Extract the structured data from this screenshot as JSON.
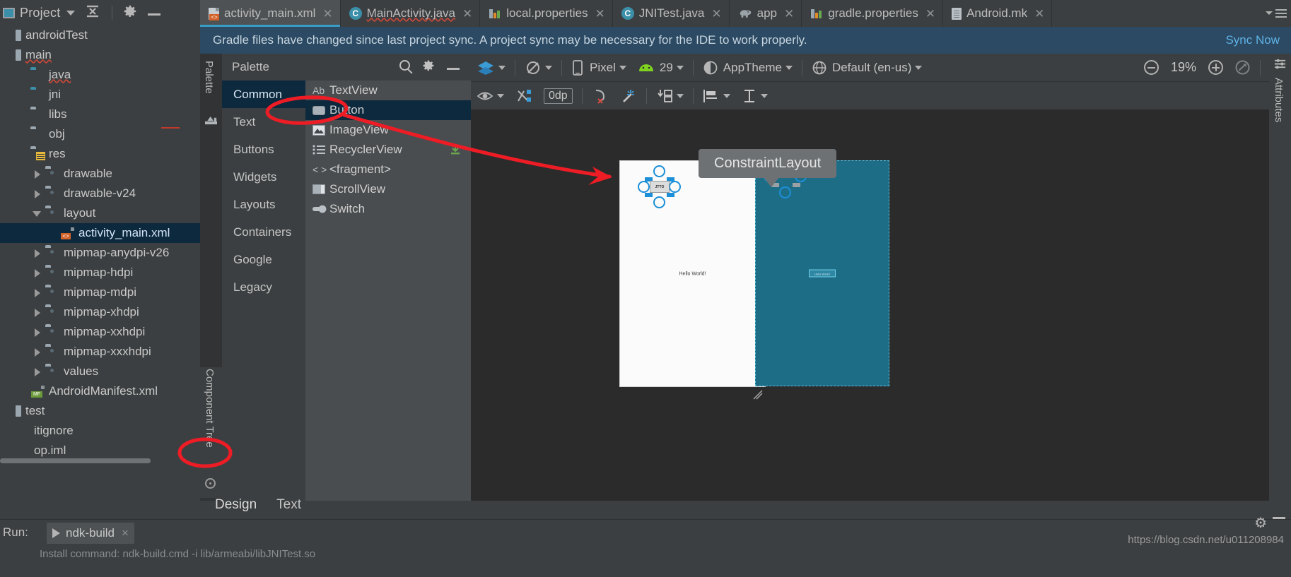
{
  "window": {
    "project_panel_title": "Project",
    "ide": "Android Studio"
  },
  "project_panel": {
    "title": "Project",
    "buttons": {
      "collapse_all": "collapse-all",
      "settings": "settings",
      "hide": "hide"
    },
    "tree": [
      {
        "label": "androidTest",
        "icon": "module-icon",
        "indent": 0,
        "twisty": "none",
        "selected": false,
        "squiggle": false
      },
      {
        "label": "main",
        "icon": "module-icon",
        "indent": 0,
        "twisty": "none",
        "selected": false,
        "squiggle": true
      },
      {
        "label": "java",
        "icon": "source-folder-icon",
        "indent": 1,
        "twisty": "none",
        "selected": false,
        "squiggle": true
      },
      {
        "label": "jni",
        "icon": "source-folder-icon",
        "indent": 1,
        "twisty": "none",
        "selected": false,
        "squiggle": false
      },
      {
        "label": "libs",
        "icon": "folder-icon",
        "indent": 1,
        "twisty": "none",
        "selected": false,
        "squiggle": false
      },
      {
        "label": "obj",
        "icon": "folder-icon",
        "indent": 1,
        "twisty": "none",
        "selected": false,
        "squiggle": false
      },
      {
        "label": "res",
        "icon": "res-folder-icon",
        "indent": 1,
        "twisty": "none",
        "selected": false,
        "squiggle": false
      },
      {
        "label": "drawable",
        "icon": "android-folder-icon",
        "indent": 2,
        "twisty": "closed",
        "selected": false,
        "squiggle": false
      },
      {
        "label": "drawable-v24",
        "icon": "android-folder-icon",
        "indent": 2,
        "twisty": "closed",
        "selected": false,
        "squiggle": false
      },
      {
        "label": "layout",
        "icon": "android-folder-icon",
        "indent": 2,
        "twisty": "open",
        "selected": false,
        "squiggle": false
      },
      {
        "label": "activity_main.xml",
        "icon": "xml-layout-icon",
        "indent": 3,
        "twisty": "none",
        "selected": true,
        "squiggle": false
      },
      {
        "label": "mipmap-anydpi-v26",
        "icon": "android-folder-icon",
        "indent": 2,
        "twisty": "closed",
        "selected": false,
        "squiggle": false
      },
      {
        "label": "mipmap-hdpi",
        "icon": "android-folder-icon",
        "indent": 2,
        "twisty": "closed",
        "selected": false,
        "squiggle": false
      },
      {
        "label": "mipmap-mdpi",
        "icon": "android-folder-icon",
        "indent": 2,
        "twisty": "closed",
        "selected": false,
        "squiggle": false
      },
      {
        "label": "mipmap-xhdpi",
        "icon": "android-folder-icon",
        "indent": 2,
        "twisty": "closed",
        "selected": false,
        "squiggle": false
      },
      {
        "label": "mipmap-xxhdpi",
        "icon": "android-folder-icon",
        "indent": 2,
        "twisty": "closed",
        "selected": false,
        "squiggle": false
      },
      {
        "label": "mipmap-xxxhdpi",
        "icon": "android-folder-icon",
        "indent": 2,
        "twisty": "closed",
        "selected": false,
        "squiggle": false
      },
      {
        "label": "values",
        "icon": "android-folder-icon",
        "indent": 2,
        "twisty": "closed",
        "selected": false,
        "squiggle": false
      },
      {
        "label": "AndroidManifest.xml",
        "icon": "manifest-icon",
        "indent": 1,
        "twisty": "none",
        "selected": false,
        "squiggle": false
      },
      {
        "label": "test",
        "icon": "module-icon",
        "indent": 0,
        "twisty": "none",
        "selected": false,
        "squiggle": false
      },
      {
        "label": "itignore",
        "icon": "none",
        "indent": 0,
        "twisty": "none",
        "selected": false,
        "squiggle": false
      },
      {
        "label": "op.iml",
        "icon": "none",
        "indent": 0,
        "twisty": "none",
        "selected": false,
        "squiggle": false
      }
    ]
  },
  "editor_tabs": [
    {
      "label": "activity_main.xml",
      "icon": "xml-layout-icon",
      "active": true
    },
    {
      "label": "MainActivity.java",
      "icon": "java-class-icon",
      "active": false,
      "squiggle": true
    },
    {
      "label": "local.properties",
      "icon": "properties-icon",
      "active": false
    },
    {
      "label": "JNITest.java",
      "icon": "java-class-icon",
      "active": false
    },
    {
      "label": "app",
      "icon": "gradle-elephant-icon",
      "active": false
    },
    {
      "label": "gradle.properties",
      "icon": "properties-icon",
      "active": false
    },
    {
      "label": "Android.mk",
      "icon": "makefile-icon",
      "active": false
    }
  ],
  "sync_banner": {
    "message": "Gradle files have changed since last project sync. A project sync may be necessary for the IDE to work properly.",
    "action_label": "Sync Now",
    "action_color": "#5fb3e8",
    "background": "#2c4a63"
  },
  "palette": {
    "strip_label": "Palette",
    "title": "Palette",
    "search_placeholder": "Search",
    "categories": [
      {
        "label": "Common",
        "active": true
      },
      {
        "label": "Text",
        "active": false
      },
      {
        "label": "Buttons",
        "active": false
      },
      {
        "label": "Widgets",
        "active": false
      },
      {
        "label": "Layouts",
        "active": false
      },
      {
        "label": "Containers",
        "active": false
      },
      {
        "label": "Google",
        "active": false
      },
      {
        "label": "Legacy",
        "active": false
      }
    ],
    "items": [
      {
        "label": "TextView",
        "icon": "ab-text-icon",
        "selected": false,
        "download": false
      },
      {
        "label": "Button",
        "icon": "button-icon",
        "selected": true,
        "download": false
      },
      {
        "label": "ImageView",
        "icon": "image-icon",
        "selected": false,
        "download": false
      },
      {
        "label": "RecyclerView",
        "icon": "list-icon",
        "selected": false,
        "download": true
      },
      {
        "label": "<fragment>",
        "icon": "code-brackets-icon",
        "selected": false,
        "download": false
      },
      {
        "label": "ScrollView",
        "icon": "scrollview-icon",
        "selected": false,
        "download": false
      },
      {
        "label": "Switch",
        "icon": "switch-icon",
        "selected": false,
        "download": false
      }
    ]
  },
  "component_tree": {
    "strip_label": "Component Tree"
  },
  "attributes_panel": {
    "strip_label": "Attributes"
  },
  "design_toolbar": {
    "row1": [
      {
        "name": "design-surface-mode",
        "icon": "layers-icon",
        "label": "",
        "caret": true
      },
      {
        "name": "orientation",
        "icon": "rotate-icon",
        "label": "",
        "caret": true
      },
      {
        "name": "device",
        "icon": "phone-icon",
        "label": "Pixel",
        "caret": true
      },
      {
        "name": "api-level",
        "icon": "android-head-icon",
        "label": "29",
        "caret": true
      },
      {
        "name": "theme",
        "icon": "theme-contrast-icon",
        "label": "AppTheme",
        "caret": true
      },
      {
        "name": "locale",
        "icon": "globe-icon",
        "label": "Default (en-us)",
        "caret": true
      }
    ],
    "zoom_out_label": "zoom-out",
    "zoom_level": "19%",
    "zoom_in_label": "zoom-in",
    "zoom_fit_label": "zoom-to-fit",
    "error_count_icon": "error-badge",
    "row2": [
      {
        "name": "view-options",
        "icon": "eye-icon",
        "label": "",
        "caret": true
      },
      {
        "name": "toggle-autoconnect",
        "icon": "autoconnect-icon",
        "label": "",
        "caret": false
      },
      {
        "name": "default-margin",
        "icon": "margin-icon",
        "label": "0dp",
        "caret": false
      },
      {
        "name": "clear-constraints",
        "icon": "clear-constraints-icon",
        "label": "",
        "caret": false
      },
      {
        "name": "infer-constraints",
        "icon": "magic-wand-icon",
        "label": "",
        "caret": false
      },
      {
        "name": "guidelines",
        "icon": "guideline-icon",
        "label": "",
        "caret": true
      },
      {
        "name": "align",
        "icon": "align-icon",
        "label": "",
        "caret": true
      },
      {
        "name": "baseline",
        "icon": "baseline-icon",
        "label": "",
        "caret": true
      }
    ]
  },
  "canvas": {
    "preview_text": "Hello World!",
    "blueprint_widget_label": "Hello World!",
    "widget_label": "JTTO",
    "tooltip": "ConstraintLayout"
  },
  "editor_mode_tabs": [
    {
      "label": "Design",
      "active": true
    },
    {
      "label": "Text",
      "active": false
    }
  ],
  "run_bar": {
    "label": "Run:",
    "config_name": "ndk-build",
    "close_label": "×",
    "console_text": "Install command: ndk-build.cmd -i lib/armeabi/libJNITest.so"
  },
  "watermark": "https://blog.csdn.net/u011208984",
  "colors": {
    "accent_blue": "#3b9bc4",
    "selection_blue": "#0d293e",
    "annotation_red": "#ee1c25",
    "error_red": "#d64c41",
    "blueprint_bg": "#1e6d87",
    "panel_bg": "#3c3f41",
    "canvas_bg": "#2b2b2b"
  }
}
